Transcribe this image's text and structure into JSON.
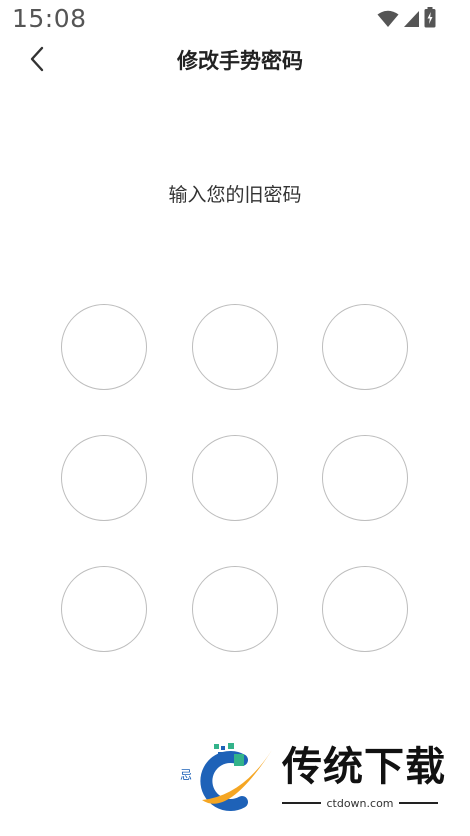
{
  "status_bar": {
    "time": "15:08",
    "icons": [
      "wifi-icon",
      "cellular-signal-icon",
      "battery-charging-icon"
    ]
  },
  "header": {
    "title": "修改手势密码",
    "back_icon": "chevron-left-icon"
  },
  "prompt": {
    "text": "输入您的旧密码"
  },
  "pattern": {
    "rows": 3,
    "cols": 3,
    "dots": [
      1,
      2,
      3,
      4,
      5,
      6,
      7,
      8,
      9
    ],
    "selected": []
  },
  "watermark": {
    "small_char": "忌",
    "brand": "传统下载",
    "domain": "ctdown.com",
    "colors": {
      "blue": "#1e62b8",
      "orange": "#f5a623",
      "green": "#33b38a"
    }
  },
  "colors": {
    "background": "#ffffff",
    "dot_border": "#bdbdbd",
    "text": "#222222"
  }
}
